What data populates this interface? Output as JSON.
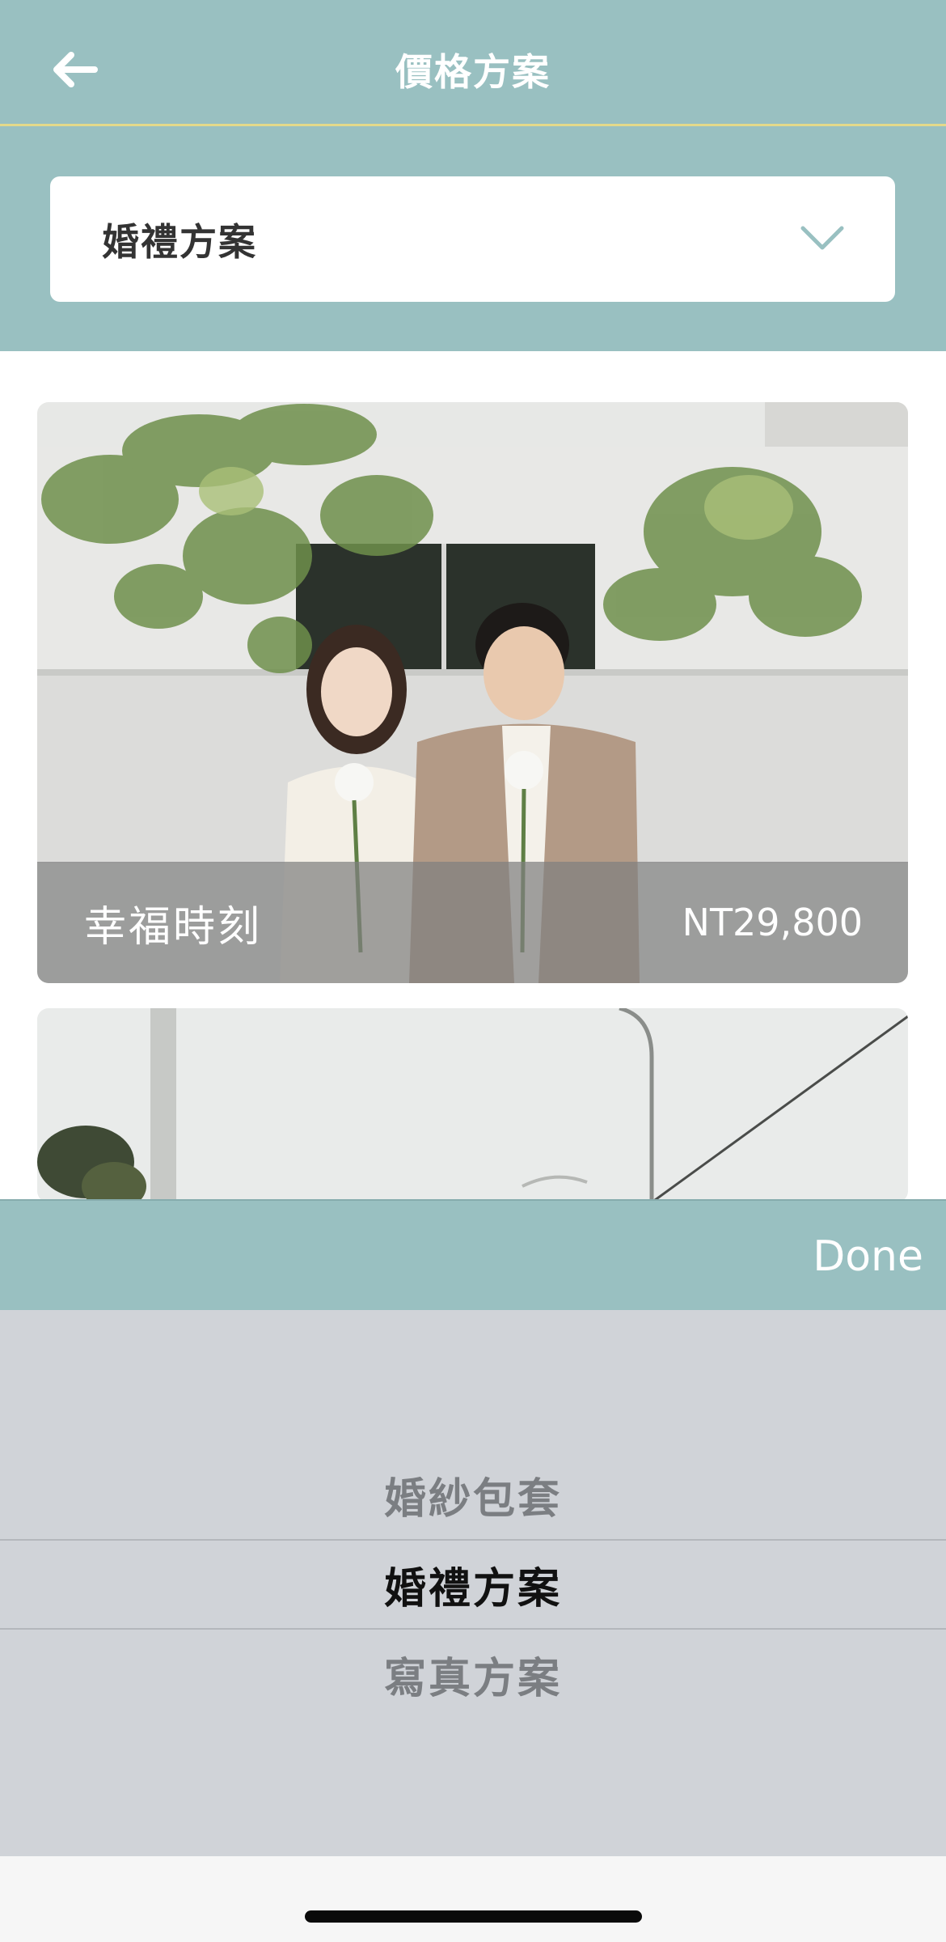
{
  "nav": {
    "title": "價格方案",
    "back_icon": "arrow-left-icon",
    "bg_color": "#99c0c1",
    "divider_color": "#e3d98a"
  },
  "category_select": {
    "value": "婚禮方案",
    "chevron_icon": "chevron-down-icon"
  },
  "plans": [
    {
      "name": "幸福時刻",
      "price": "NT29,800",
      "photo": "couple-photo"
    },
    {
      "name": "",
      "price": "",
      "photo": "street-photo"
    }
  ],
  "picker": {
    "done_label": "Done",
    "options": [
      "婚紗包套",
      "婚禮方案",
      "寫真方案"
    ],
    "selected_index": 1
  }
}
